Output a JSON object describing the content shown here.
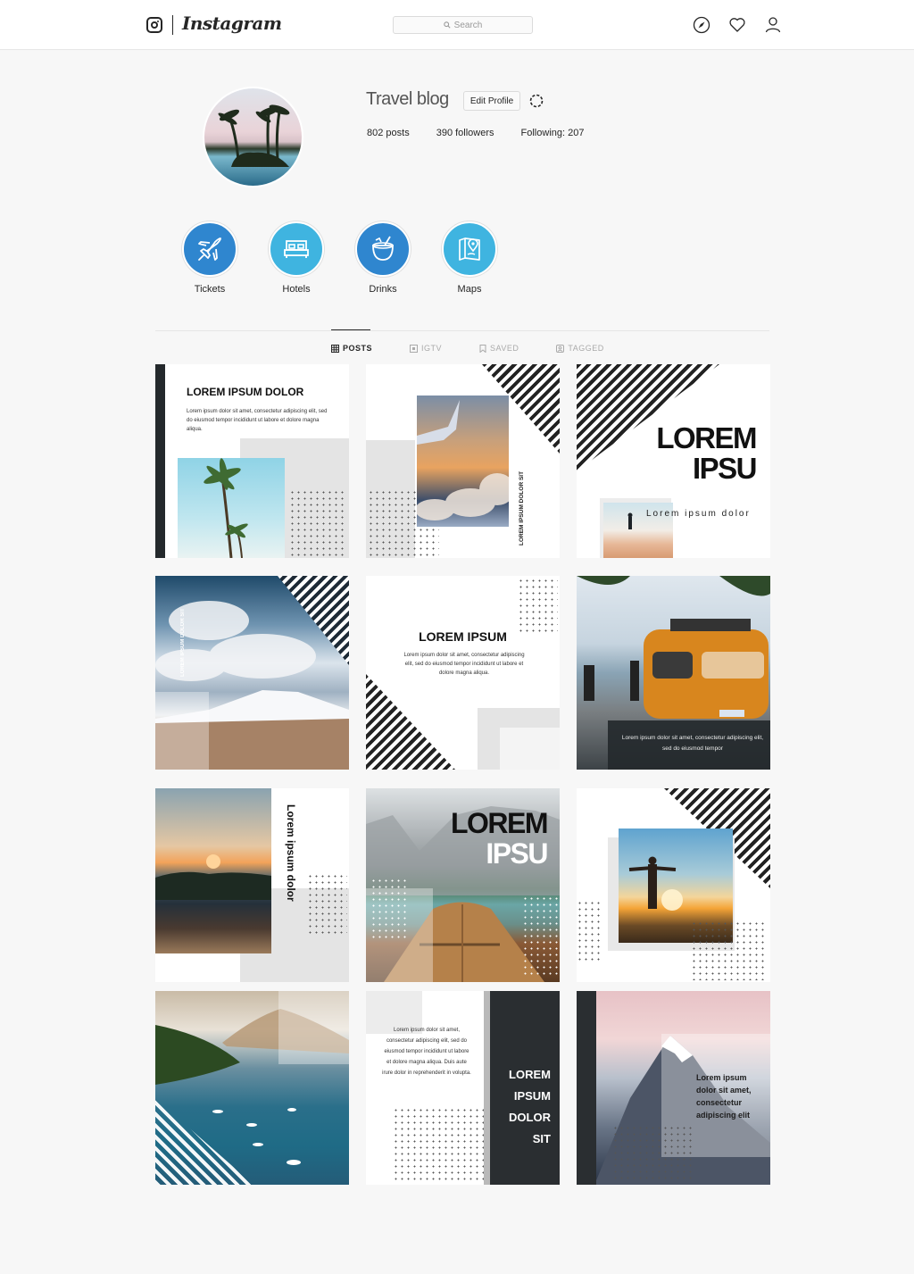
{
  "app": {
    "title": "Instagram"
  },
  "topbar": {
    "logo_icon": "instagram-camera-icon",
    "wordmark": "Instagram",
    "search_placeholder": "Search",
    "search_icon": "search-icon",
    "nav_icons": [
      "compass-icon",
      "heart-icon",
      "user-icon"
    ]
  },
  "profile": {
    "name": "Travel blog",
    "edit_label": "Edit Profile",
    "settings_icon": "gear-icon",
    "stats": {
      "posts": "802  posts",
      "followers": "390  followers",
      "following": "Following: 207"
    }
  },
  "highlights": [
    {
      "label": "Tickets",
      "icon": "airplane-icon",
      "color": "#2f86cf"
    },
    {
      "label": "Hotels",
      "icon": "bed-icon",
      "color": "#3fb4e0"
    },
    {
      "label": "Drinks",
      "icon": "coconut-drink-icon",
      "color": "#2f86cf"
    },
    {
      "label": "Maps",
      "icon": "map-pin-icon",
      "color": "#3fb4e0"
    }
  ],
  "tabs": [
    {
      "label": "POSTS",
      "icon": "grid-icon",
      "active": true
    },
    {
      "label": "IGTV",
      "icon": "igtv-icon",
      "active": false
    },
    {
      "label": "SAVED",
      "icon": "bookmark-icon",
      "active": false
    },
    {
      "label": "TAGGED",
      "icon": "tag-icon",
      "active": false
    }
  ],
  "posts": [
    {
      "heading": "LOREM IPSUM DOLOR",
      "body": "Lorem ipsum dolor sit amet, consectetur adipiscing elit, sed do eiusmod tempor incididunt ut labore et dolore magna aliqua.",
      "image": "palm-trees-photo"
    },
    {
      "vertical": "LOREM IPSUM DOLOR SIT",
      "image": "airplane-wing-sunset-photo"
    },
    {
      "heading": "LOREM IPSU",
      "subtitle": "Lorem ipsum dolor",
      "image": "desert-walker-photo"
    },
    {
      "vertical": "LOREM IPSUM DOLOR SIT",
      "image": "snowy-mountain-clouds-photo"
    },
    {
      "heading": "LOREM IPSUM",
      "body": "Lorem ipsum dolor sit amet, consectetur adipiscing elit, sed do eiusmod tempor incididunt ut labore et dolore magna aliqua."
    },
    {
      "body": "Lorem ipsum dolor sit amet, consectetur adipiscing elit, sed do eiusmod tempor",
      "image": "orange-van-beach-photo"
    },
    {
      "vertical": "Lorem ipsum dolor",
      "image": "lake-sunset-photo"
    },
    {
      "heading_line1": "LOREM",
      "heading_line2": "IPSU",
      "image": "boat-lake-mountains-photo"
    },
    {
      "image": "man-arms-open-sunset-photo"
    },
    {
      "image": "island-bay-boats-photo"
    },
    {
      "body": "Lorem ipsum dolor sit amet, consectetur adipiscing elit, sed do eiusmod tempor incididunt ut labore et dolore magna aliqua. Duis aute irure dolor in reprehenderit in volupta.",
      "heading_lines": [
        "LOREM",
        "IPSUM",
        "DOLOR",
        "SIT"
      ]
    },
    {
      "body": "Lorem ipsum dolor sit amet, consectetur adipiscing elit",
      "image": "mountain-peak-pink-sky-photo"
    }
  ]
}
